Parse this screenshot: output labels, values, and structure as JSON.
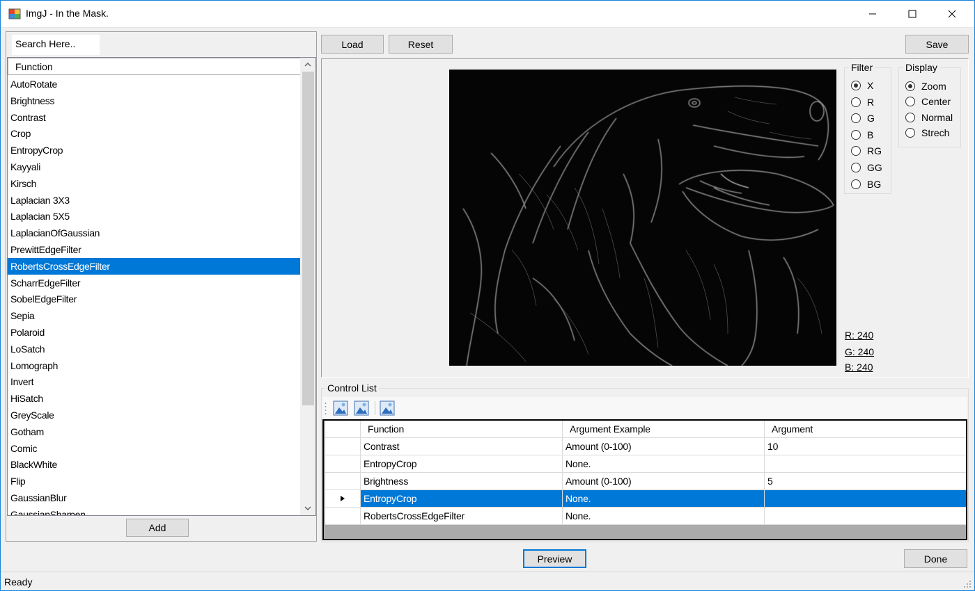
{
  "window": {
    "title": "ImgJ - In the Mask.",
    "minimize_glyph": "—",
    "maximize_glyph": "☐",
    "close_glyph": "✕"
  },
  "toolbar": {
    "load_label": "Load",
    "reset_label": "Reset",
    "save_label": "Save"
  },
  "search": {
    "placeholder": "Search Here.."
  },
  "function_list": {
    "header": "Function",
    "selected_index": 11,
    "items": [
      "AutoRotate",
      "Brightness",
      "Contrast",
      "Crop",
      "EntropyCrop",
      "Kayyali",
      "Kirsch",
      "Laplacian 3X3",
      "Laplacian 5X5",
      "LaplacianOfGaussian",
      "PrewittEdgeFilter",
      "RobertsCrossEdgeFilter",
      "ScharrEdgeFilter",
      "SobelEdgeFilter",
      "Sepia",
      "Polaroid",
      "LoSatch",
      "Lomograph",
      "Invert",
      "HiSatch",
      "GreyScale",
      "Gotham",
      "Comic",
      "BlackWhite",
      "Flip",
      "GaussianBlur",
      "GaussianSharpen"
    ],
    "add_label": "Add"
  },
  "filter_group": {
    "title": "Filter",
    "selected": "X",
    "options": [
      "X",
      "R",
      "G",
      "B",
      "RG",
      "GG",
      "BG"
    ]
  },
  "display_group": {
    "title": "Display",
    "selected": "Zoom",
    "options": [
      "Zoom",
      "Center",
      "Normal",
      "Strech"
    ]
  },
  "pixel_readout": {
    "r": "R: 240",
    "g": "G: 240",
    "b": "B: 240"
  },
  "control_list": {
    "title": "Control List",
    "toolbar_icons": [
      "image-add-icon",
      "image-remove-icon",
      "image-clear-icon"
    ],
    "columns": [
      "Function",
      "Argument Example",
      "Argument"
    ],
    "selected_row": 3,
    "rows": [
      {
        "function": "Contrast",
        "example": "Amount (0-100)",
        "argument": "10"
      },
      {
        "function": "EntropyCrop",
        "example": "None.",
        "argument": ""
      },
      {
        "function": "Brightness",
        "example": "Amount (0-100)",
        "argument": "5"
      },
      {
        "function": "EntropyCrop",
        "example": "None.",
        "argument": ""
      },
      {
        "function": "RobertsCrossEdgeFilter",
        "example": "None.",
        "argument": ""
      }
    ]
  },
  "bottom": {
    "preview_label": "Preview",
    "done_label": "Done"
  },
  "status": {
    "text": "Ready"
  },
  "colors": {
    "accent": "#0078d7",
    "window_bg": "#f0f0f0",
    "image_bg": "#050505"
  }
}
